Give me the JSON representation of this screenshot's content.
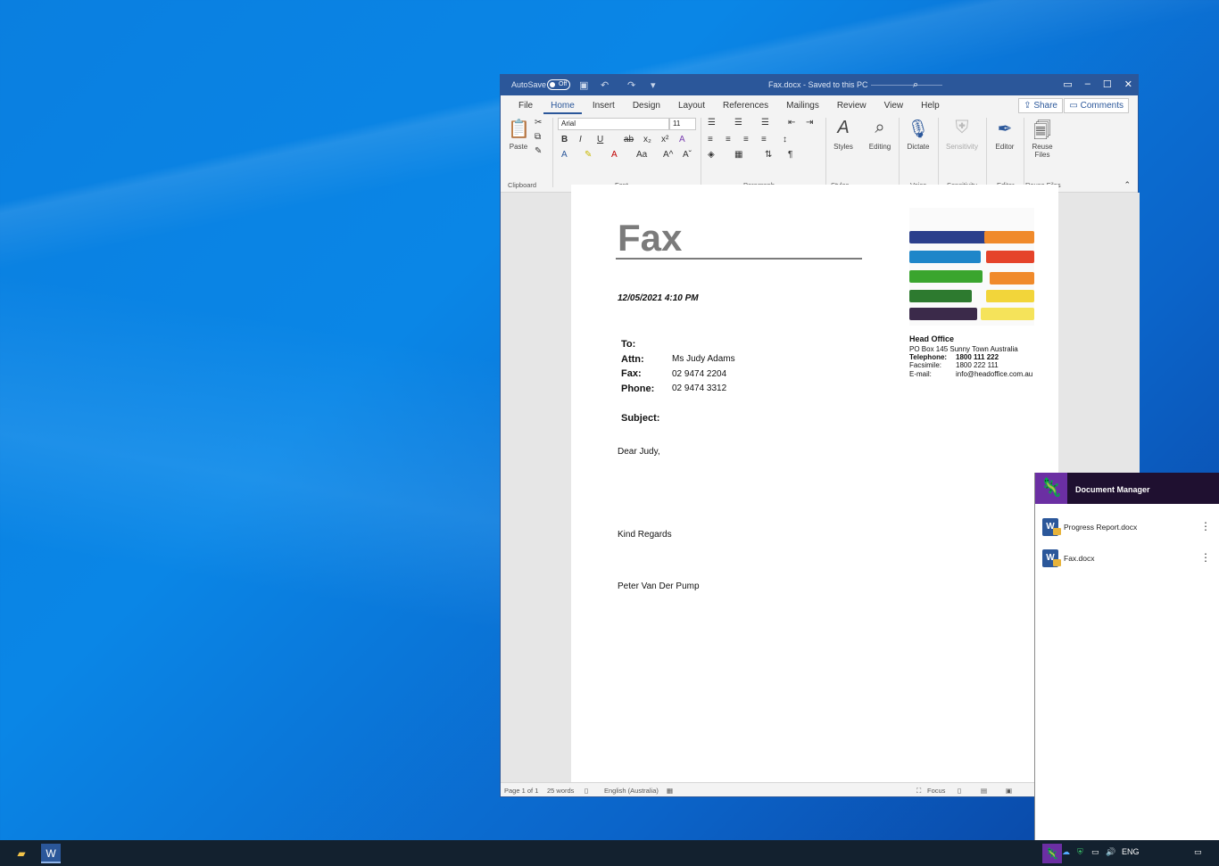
{
  "word": {
    "autosave_label": "AutoSave",
    "autosave_state": "Off",
    "doc_title": "Fax.docx  -  Saved to this PC",
    "tabs": [
      "File",
      "Home",
      "Insert",
      "Design",
      "Layout",
      "References",
      "Mailings",
      "Review",
      "View",
      "Help"
    ],
    "active_tab": "Home",
    "share": "Share",
    "comments": "Comments",
    "font_name": "Arial",
    "font_size": "11",
    "groups": {
      "clipboard": "Clipboard",
      "font": "Font",
      "paragraph": "Paragraph",
      "styles": "Styles",
      "voice": "Voice",
      "sensitivity": "Sensitivity",
      "editor": "Editor",
      "reuse": "Reuse Files"
    },
    "buttons": {
      "paste": "Paste",
      "styles": "Styles",
      "editing": "Editing",
      "dictate": "Dictate",
      "sensitivity": "Sensitivity",
      "editor": "Editor",
      "reuse_files_1": "Reuse",
      "reuse_files_2": "Files"
    },
    "statusbar": {
      "page": "Page 1 of 1",
      "words": "25 words",
      "language": "English (Australia)",
      "focus": "Focus"
    }
  },
  "document": {
    "title": "Fax",
    "date": "12/05/2021 4:10 PM",
    "fields": [
      {
        "label": "To:",
        "value": ""
      },
      {
        "label": "Attn:",
        "value": "Ms Judy Adams"
      },
      {
        "label": "Fax:",
        "value": "02 9474 2204"
      },
      {
        "label": "Phone:",
        "value": "02 9474 3312"
      }
    ],
    "subject_label": "Subject:",
    "greeting": "Dear Judy,",
    "closing": "Kind Regards",
    "signature": "Peter Van Der Pump",
    "head_office": {
      "name": "Head Office",
      "address": "PO Box 145 Sunny Town Australia",
      "tel_label": "Telephone:",
      "tel": "1800 111 222",
      "fax_label": "Facsimile:",
      "fax": "1800 222 111",
      "email_label": "E-mail:",
      "email": "info@headoffice.com.au"
    }
  },
  "doc_manager": {
    "title": "Document Manager",
    "items": [
      "Progress Report.docx",
      "Fax.docx"
    ]
  },
  "taskbar": {
    "lang": "ENG"
  },
  "colors": {
    "word_blue": "#2b579a",
    "dm_purple": "#6b2fa3",
    "taskbar": "#13212f"
  }
}
